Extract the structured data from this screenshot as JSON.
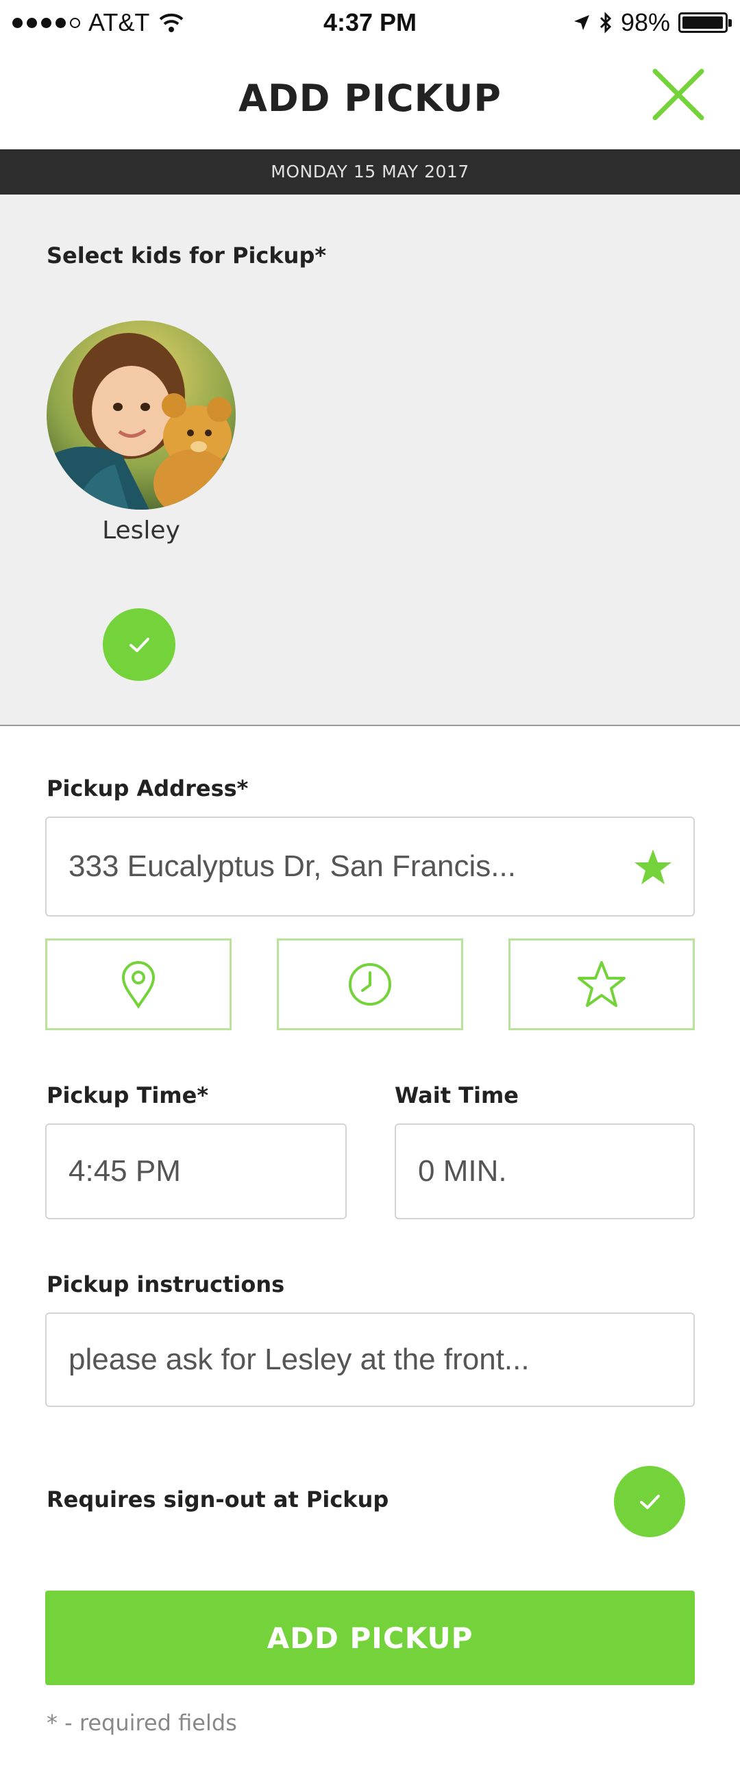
{
  "status_bar": {
    "carrier": "AT&T",
    "time": "4:37 PM",
    "battery": "98%",
    "battery_level": 0.98,
    "signal_bars": 4,
    "icons": [
      "signal-dots-icon",
      "wifi-icon",
      "location-arrow-icon",
      "bluetooth-icon",
      "battery-icon"
    ]
  },
  "header": {
    "title": "ADD PICKUP",
    "close_icon": "close-icon",
    "date": "MONDAY 15 MAY 2017"
  },
  "kids_section": {
    "label": "Select kids for Pickup*",
    "kids": [
      {
        "name": "Lesley",
        "selected": true,
        "avatar": "child-photo"
      }
    ]
  },
  "address": {
    "label": "Pickup Address*",
    "value": "333 Eucalyptus Dr, San Francis...",
    "favorite_icon": "star-icon",
    "shortcut_icons": [
      "map-pin-icon",
      "clock-icon",
      "star-outline-icon"
    ]
  },
  "pickup_time": {
    "label": "Pickup Time*",
    "value": "4:45 PM"
  },
  "wait_time": {
    "label": "Wait Time",
    "value": "0 MIN."
  },
  "instructions": {
    "label": "Pickup instructions",
    "value": "please ask for Lesley at the front..."
  },
  "sign_out": {
    "label": "Requires sign-out at Pickup",
    "checked": true
  },
  "submit_label": "ADD PICKUP",
  "footnote": "* - required fields",
  "colors": {
    "accent": "#74d23a",
    "accent_light": "#b9e39a",
    "date_bar": "#2d2d2d",
    "section_bg": "#efefef"
  }
}
